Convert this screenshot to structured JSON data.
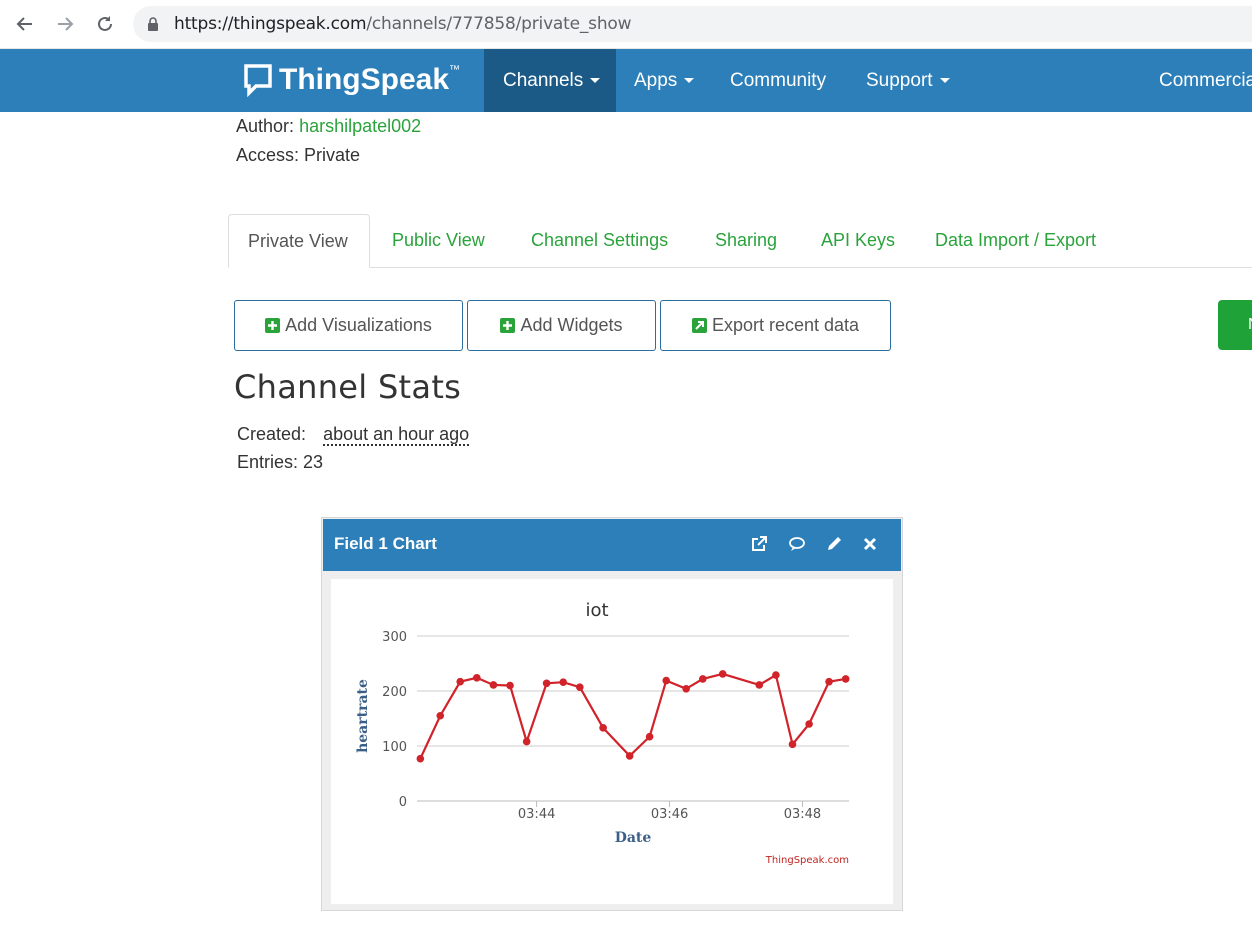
{
  "browser": {
    "url_host": "https://thingspeak.com",
    "url_path": "/channels/777858/private_show"
  },
  "navbar": {
    "brand": "ThingSpeak",
    "tm": "™",
    "items": [
      {
        "label": "Channels"
      },
      {
        "label": "Apps"
      },
      {
        "label": "Community"
      },
      {
        "label": "Support"
      },
      {
        "label": "Commercia"
      }
    ]
  },
  "channel": {
    "author_label": "Author:",
    "author": "harshilpatel002",
    "access_label": "Access:",
    "access": "Private"
  },
  "tabs": [
    {
      "label": "Private View"
    },
    {
      "label": "Public View"
    },
    {
      "label": "Channel Settings"
    },
    {
      "label": "Sharing"
    },
    {
      "label": "API Keys"
    },
    {
      "label": "Data Import / Export"
    }
  ],
  "actions": {
    "add_visualizations": "Add Visualizations",
    "add_widgets": "Add Widgets",
    "export_recent": "Export recent data",
    "green_partial": "N"
  },
  "stats": {
    "heading": "Channel Stats",
    "created_label": "Created:",
    "created_value": "about an hour ago",
    "entries_label": "Entries:",
    "entries_value": "23"
  },
  "widget": {
    "title": "Field 1 Chart",
    "credit": "ThingSpeak.com"
  },
  "colors": {
    "navbar": "#2c7fb8",
    "link_green": "#2aa33b",
    "series": "#d0232a"
  },
  "chart_data": {
    "type": "line",
    "title": "iot",
    "xlabel": "Date",
    "ylabel": "heartrate",
    "ylim": [
      0,
      300
    ],
    "yticks": [
      0,
      100,
      200,
      300
    ],
    "x_tick_labels": [
      "03:44",
      "03:46",
      "03:48"
    ],
    "x_tick_minutes": [
      224,
      226,
      228
    ],
    "xlim_minutes": [
      222.2,
      228.7
    ],
    "grid": true,
    "series": [
      {
        "x_minutes": [
          222.25,
          222.55,
          222.85,
          223.1,
          223.35,
          223.6,
          223.85,
          224.15,
          224.4,
          224.65,
          225.0,
          225.4,
          225.7,
          225.95,
          226.25,
          226.5,
          226.8,
          227.35,
          227.6,
          227.85,
          228.1,
          228.4,
          228.65
        ],
        "values": [
          77,
          155,
          217,
          224,
          211,
          210,
          108,
          214,
          216,
          207,
          133,
          82,
          117,
          219,
          204,
          222,
          231,
          211,
          229,
          103,
          140,
          217,
          222
        ]
      }
    ]
  }
}
